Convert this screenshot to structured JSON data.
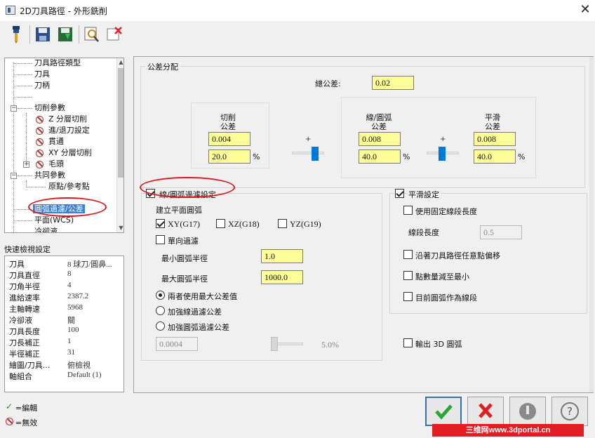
{
  "window": {
    "title": "2D刀具路徑 - 外形銑削",
    "close": "✕"
  },
  "tree": {
    "items": [
      "刀具路徑類型",
      "刀具",
      "刀柄",
      "",
      "切削參數",
      "Z 分層切削",
      "進/退刀設定",
      "貫通",
      "XY 分層切削",
      "毛頭",
      "共同參數",
      "原點/參考點",
      "",
      "圓弧過濾/公差",
      "平面(WCS)",
      "冷卻液"
    ]
  },
  "quickview": {
    "title": "快速檢視設定",
    "rows": [
      {
        "k": "刀具",
        "v": "8 球刀/圓鼻..."
      },
      {
        "k": "刀具直徑",
        "v": "8"
      },
      {
        "k": "刀角半徑",
        "v": "4"
      },
      {
        "k": "進給速率",
        "v": "2387.2"
      },
      {
        "k": "主軸轉速",
        "v": "5968"
      },
      {
        "k": "冷卻液",
        "v": "關"
      },
      {
        "k": "刀具長度",
        "v": "100"
      },
      {
        "k": "刀長補正",
        "v": "1"
      },
      {
        "k": "半徑補正",
        "v": "31"
      },
      {
        "k": "繪圖/刀具...",
        "v": "俯檢視"
      },
      {
        "k": "軸組合",
        "v": "Default (1)"
      }
    ]
  },
  "legend": {
    "edit": "=編輯",
    "invalid": "=無效"
  },
  "tolerance": {
    "group_label": "公差分配",
    "total_label": "總公差:",
    "total_value": "0.02",
    "cut_label": "切削\n公差",
    "cut_value": "0.004",
    "cut_pct": "20.0",
    "arc_label": "線/圓弧\n公差",
    "arc_value": "0.008",
    "arc_pct": "40.0",
    "smooth_label": "平滑\n公差",
    "smooth_value": "0.008",
    "smooth_pct": "40.0",
    "pct_sign": "%",
    "plus": "+"
  },
  "arcfilter": {
    "label": "線/圓弧過濾設定",
    "checked": true,
    "plane_label": "建立平面圓弧",
    "xy": "XY(G17)",
    "xz": "XZ(G18)",
    "yz": "YZ(G19)",
    "oneway": "單向過濾",
    "min_radius_label": "最小圓弧半徑",
    "min_radius": "1.0",
    "max_radius_label": "最大圓弧半徑",
    "max_radius": "1000.0",
    "opt1": "兩者使用最大公差值",
    "opt2": "加強線過濾公差",
    "opt3": "加強圓弧過濾公差",
    "disabled_value": "0.0004",
    "disabled_pct": "5.0%"
  },
  "smoothing": {
    "label": "平滑設定",
    "checked": true,
    "fixed_len": "使用固定線段長度",
    "seg_len_label": "線段長度",
    "seg_len": "0.5",
    "offset": "沿著刀具路徑任意點偏移",
    "reduce": "點數量減至最小",
    "as_line": "目前圓弧作為線段"
  },
  "output3d": "輸出 3D 圓弧",
  "watermark": "三维网www.3dportal.cn",
  "colors": {
    "accent": "#0078d7",
    "field_bg": "#ffff99",
    "annotation": "#e0161f"
  }
}
